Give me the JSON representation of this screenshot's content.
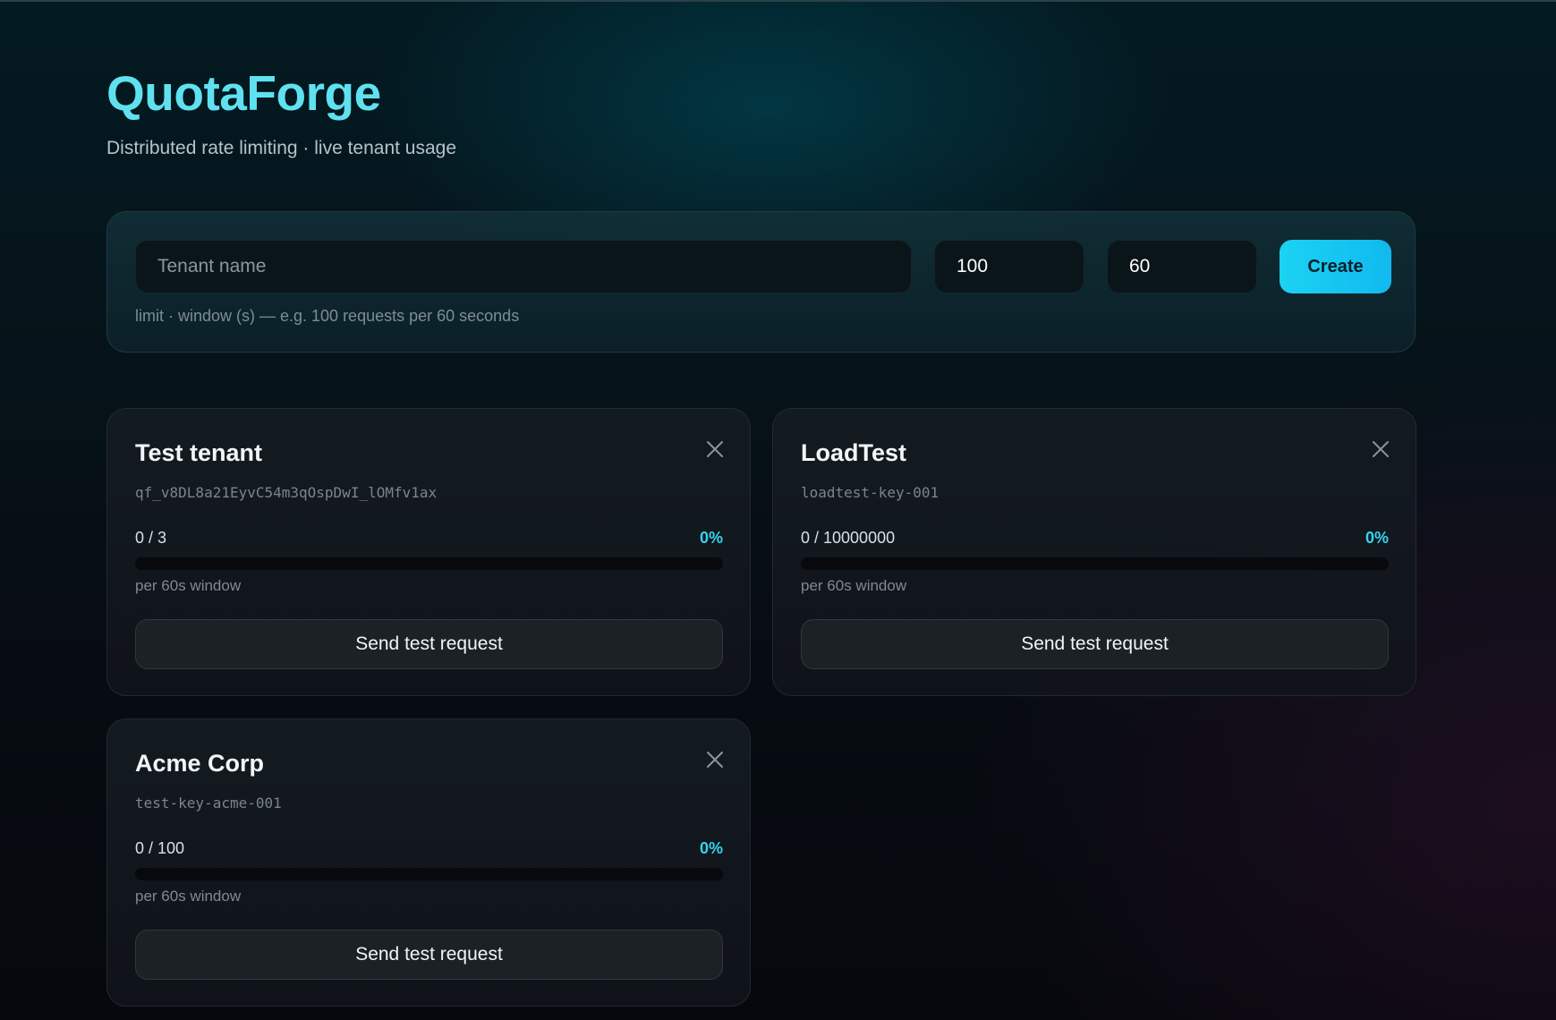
{
  "header": {
    "title": "QuotaForge",
    "subtitle": "Distributed rate limiting · live tenant usage"
  },
  "create_form": {
    "name_placeholder": "Tenant name",
    "name_value": "",
    "limit_value": "100",
    "window_value": "60",
    "create_label": "Create",
    "hint": "limit · window (s) — e.g. 100 requests per 60 seconds"
  },
  "tenants": [
    {
      "name": "Test tenant",
      "key": "qf_v8DL8a21EyvC54m3qOspDwI_lOMfv1ax",
      "usage": "0 / 3",
      "percent": "0%",
      "fill_fraction": 0,
      "window": "per 60s window",
      "send_label": "Send test request"
    },
    {
      "name": "LoadTest",
      "key": "loadtest-key-001",
      "usage": "0 / 10000000",
      "percent": "0%",
      "fill_fraction": 0,
      "window": "per 60s window",
      "send_label": "Send test request"
    },
    {
      "name": "Acme Corp",
      "key": "test-key-acme-001",
      "usage": "0 / 100",
      "percent": "0%",
      "fill_fraction": 0,
      "window": "per 60s window",
      "send_label": "Send test request"
    }
  ],
  "icons": {
    "close": "close-icon"
  },
  "colors": {
    "accent": "#5fe1f0",
    "percent": "#36d3ee",
    "create_button": "#1bd3f2"
  }
}
